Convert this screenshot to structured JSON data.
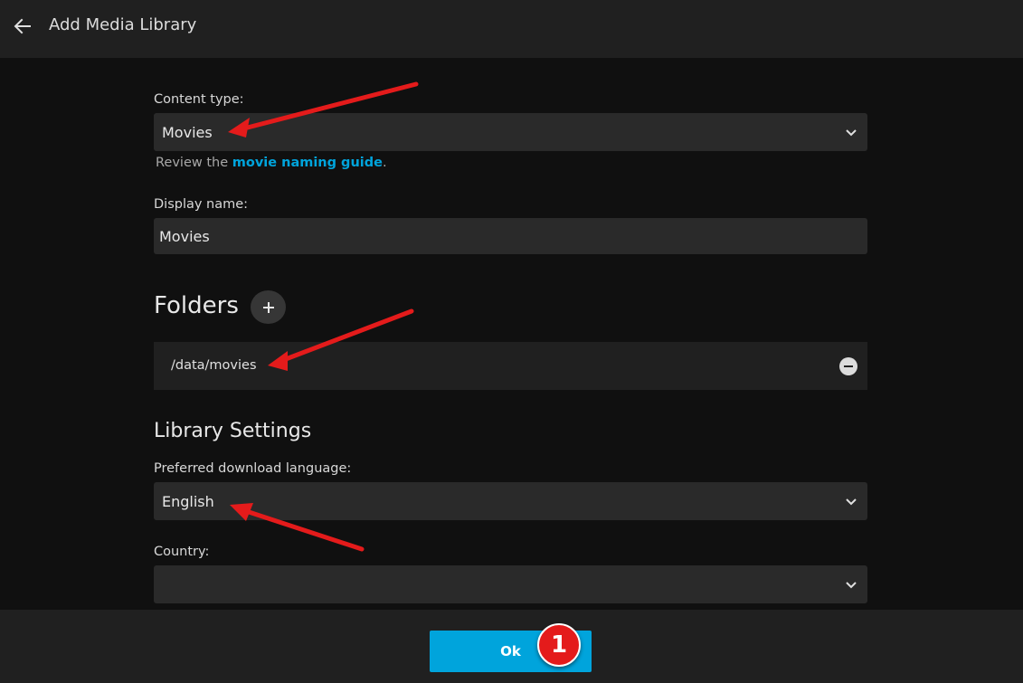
{
  "header": {
    "title": "Add Media Library"
  },
  "content_type": {
    "label": "Content type:",
    "value": "Movies",
    "hint_prefix": "Review the ",
    "hint_link": "movie naming guide",
    "hint_suffix": "."
  },
  "display_name": {
    "label": "Display name:",
    "value": "Movies"
  },
  "folders": {
    "title": "Folders",
    "add_icon": "plus-icon",
    "items": [
      {
        "path": "/data/movies",
        "remove_icon": "minus-circle-icon"
      }
    ]
  },
  "library_settings": {
    "title": "Library Settings",
    "language_label": "Preferred download language:",
    "language_value": "English",
    "country_label": "Country:",
    "country_value": ""
  },
  "footer": {
    "ok_label": "Ok",
    "step_badge": "1"
  },
  "colors": {
    "accent": "#00a4dc",
    "annotation": "#e41b1b"
  }
}
